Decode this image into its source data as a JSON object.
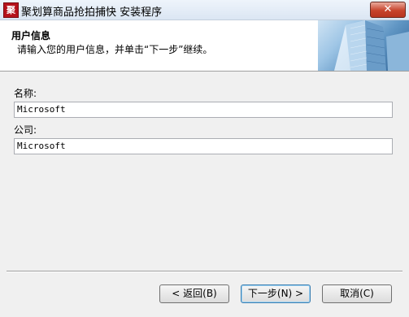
{
  "window": {
    "title": "聚划算商品抢拍捕快 安装程序",
    "icon_text": "聚",
    "close_label": "✕"
  },
  "header": {
    "title": "用户信息",
    "subtitle": "请输入您的用户信息，并单击“下一步”继续。"
  },
  "form": {
    "name_label": "名称:",
    "name_value": "Microsoft",
    "company_label": "公司:",
    "company_value": "Microsoft"
  },
  "buttons": {
    "back_label": "< 返回(B)",
    "next_label": "下一步(N) >",
    "cancel_label": "取消(C)"
  }
}
